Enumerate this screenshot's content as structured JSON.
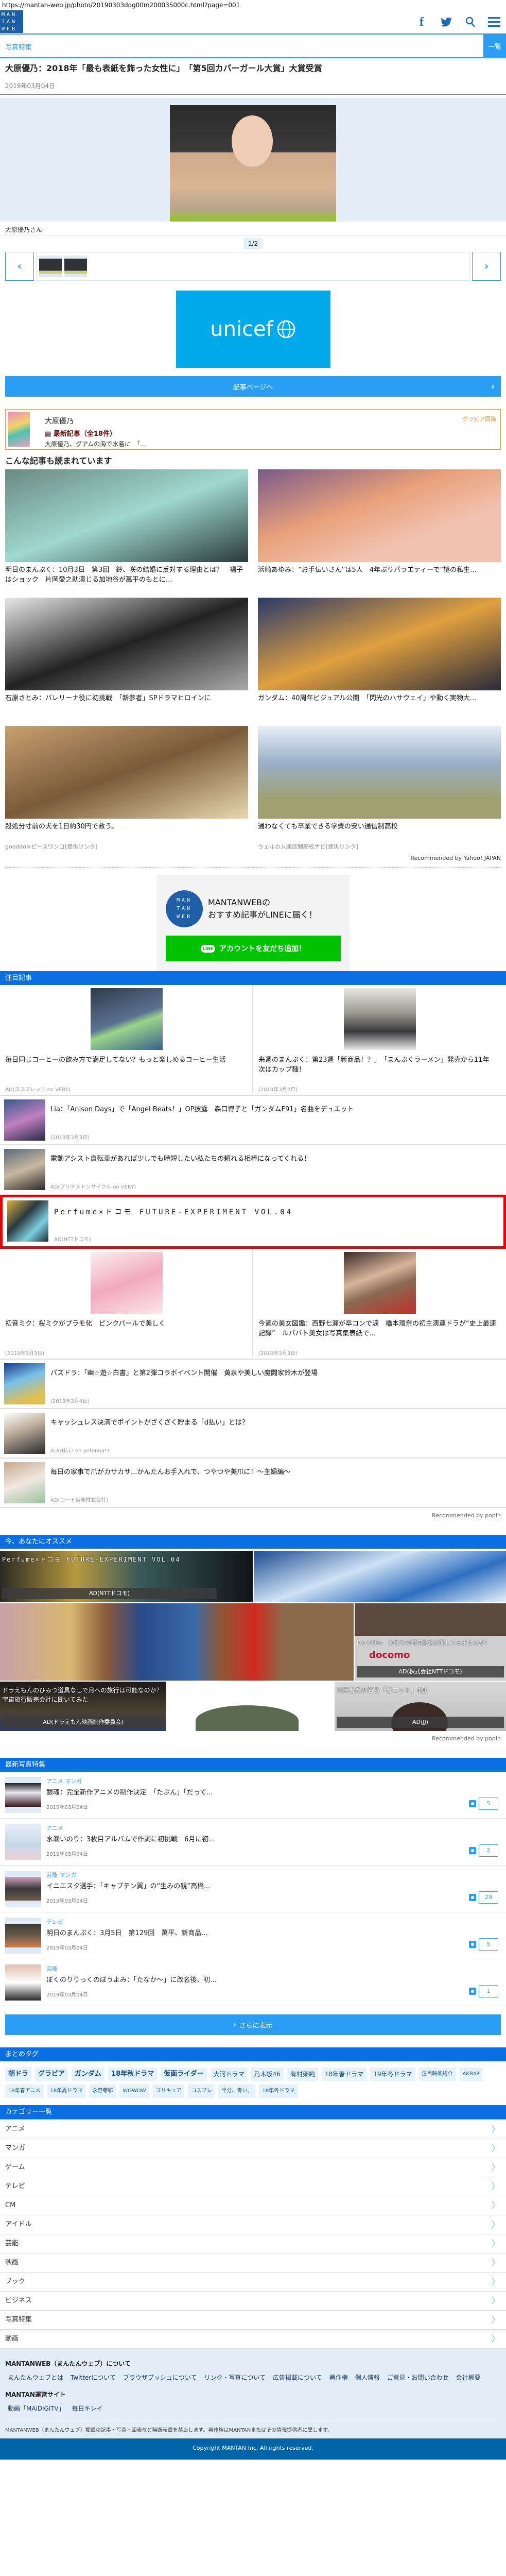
{
  "url": "https://mantan-web.jp/photo/20190303dog00m200035000c.html?page=001",
  "header": {
    "logo": "MAN TAN WEB",
    "icons": [
      "facebook-icon",
      "twitter-icon",
      "search-icon",
      "menu-icon"
    ]
  },
  "subbar": {
    "label": "写真特集",
    "list_button": "一覧"
  },
  "article": {
    "title": "大原優乃：2018年「最も表紙を飾った女性に」　「第5回カバーガール大賞」大賞受賞",
    "date": "2019年03月04日",
    "caption": "大原優乃さん",
    "counter": "1/2",
    "prev": "‹",
    "next": "›"
  },
  "ad": {
    "brand": "unicef"
  },
  "article_button": "記事ページへ",
  "gravure": {
    "name": "大原優乃",
    "latest": "最新記事（全18件）",
    "excerpt": "大原優乃、グアムの海で水着に　「...",
    "label": "グラビア図鑑"
  },
  "read_heading": "こんな記事も読まれています",
  "read_grid": [
    {
      "title": "明日のまんぷく：10月3日　第3回　鈴、咲の結婚に反対する理由とは？　福子はショック　片岡愛之助演じる加地谷が萬平のもとに…",
      "source": ""
    },
    {
      "title": "浜崎あゆみ：“お手伝いさん”は5人　4年ぶりバラエティーで“謎の私生…",
      "source": ""
    },
    {
      "title": "石原さとみ：バレリーナ役に初挑戦　「新参者」SPドラマヒロインに",
      "source": ""
    },
    {
      "title": "ガンダム：40周年ビジュアル公開　「閃光のハサウェイ」や動く実物大…",
      "source": ""
    },
    {
      "title": "殺処分寸前の犬を1日約30円で救う。",
      "source": "gooddo×ピースワンコ[提供リンク]"
    },
    {
      "title": "通わなくても卒業できる学費の安い通信制高校",
      "source": "ウェルカム通信制高校ナビ[提供リンク]"
    }
  ],
  "yahoo_credit": "Recommended by Yahoo! JAPAN",
  "line_promo": {
    "logo": "MAN TAN WEB",
    "line1": "MANTANWEBの",
    "line2": "おすすめ記事がLINEに届く！",
    "button": "アカウントを友だち追加！",
    "button_icon": "LINE"
  },
  "featured": {
    "heading": "注目記事",
    "top": [
      {
        "title": "毎日同じコーヒーの飲み方で満足してない？もっと楽しめるコーヒー生活",
        "source": "AD(ネスプレッソ on VERY)"
      },
      {
        "title": "来週のまんぷく：第23週「新商品！？」　「まんぷくラーメン」発売から11年　次はカップ麺！",
        "source": "(2019年3月2日)"
      }
    ],
    "list1": [
      {
        "title": "Lia：「Anison Days」で「Angel Beats！」OP披露　森口博子と「ガンダムF91」名曲をデュエット",
        "source": "(2019年3月3日)"
      },
      {
        "title": "電動アシスト自転車があれば少しでも時短したい私たちの頼れる相棒になってくれる！",
        "source": "AD(ブリヂストンサイクル on VERY)"
      }
    ],
    "highlight": {
      "title": "Perfume×ドコモ FUTURE-EXPERIMENT VOL.04",
      "source": "AD(NTTドコモ)"
    },
    "mid": [
      {
        "title": "初音ミク：桜ミクがプラモ化　ピンクパールで美しく",
        "source": "(2019年3月3日)"
      },
      {
        "title": "今週の美女図鑑：西野七瀬が卒コンで涙　橋本環奈の初主演連ドラが“史上最速記録”　ルパパト美女は写真集表紙で…",
        "source": "(2019年3月3日)"
      }
    ],
    "list2": [
      {
        "title": "パズドラ：「幽☆遊☆白書」と第2弾コラボイベント開催　黄泉や美しい魔闘家鈴木が登場",
        "source": "(2019年3月4日)"
      },
      {
        "title": "キャッシュレス決済でポイントがざくざく貯まる「d払い」とは？",
        "source": "AD(d払い on antenna*)"
      },
      {
        "title": "毎日の家事で爪がカサカサ...かんたんお手入れで、つやつや美爪に！～主婦編～",
        "source": "AD(ロート製薬株式会社)"
      }
    ],
    "credit": "Recommended by popIn"
  },
  "recommend": {
    "heading": "今、あなたにオススメ",
    "tiles": [
      {
        "title": "Perfume×ドコモ FUTURE-EXPERIMENT VOL.04",
        "source": "AD(NTTドコモ)"
      },
      {
        "title": "",
        "source": ""
      },
      {
        "title": "",
        "source": ""
      },
      {
        "title": "For ONEs　あなたの耳年齢を診断してみませんか？",
        "source": "AD(株式会社NTTドコモ)",
        "brand": "docomo"
      },
      {
        "title": "ドラえもんのひみつ道具なしで月への旅行は可能なのか？宇宙旅行販売会社に聞いてみた",
        "source": "AD(ドラえもん映画制作委員会)"
      },
      {
        "title": "",
        "source": ""
      },
      {
        "title": "川口春奈が着る「春ニット」4選",
        "source": "AD(JJ)"
      }
    ],
    "credit": "Recommended by popIn"
  },
  "latest_photos": {
    "heading": "最新写真特集",
    "items": [
      {
        "category": "アニメ マンガ",
        "title": "銀魂：完全新作アニメの制作決定　「たぶん」「だって...",
        "date": "2019年03月04日",
        "count": "5"
      },
      {
        "category": "アニメ",
        "title": "水瀬いのり：3枚目アルバムで作詞に初挑戦　6月に初...",
        "date": "2019年03月04日",
        "count": "2"
      },
      {
        "category": "芸能 マンガ",
        "title": "イニエスタ選手：「キャプテン翼」の“生みの親”高橋...",
        "date": "2019年03月04日",
        "count": "29"
      },
      {
        "category": "テレビ",
        "title": "明日のまんぷく：3月5日　第129回　萬平、新商品...",
        "date": "2019年03月04日",
        "count": "5"
      },
      {
        "category": "芸能",
        "title": "ぼくのりりっくのぼうよみ：「たなか～」に改名後、初...",
        "date": "2019年03月04日",
        "count": "1"
      }
    ],
    "more_button": "さらに表示"
  },
  "tags": {
    "heading": "まとめタグ",
    "items": [
      "朝ドラ",
      "グラビア",
      "ガンダム",
      "18年秋ドラマ",
      "仮面ライダー",
      "大河ドラマ",
      "乃木坂46",
      "有村架純",
      "18年春ドラマ",
      "19年冬ドラマ",
      "注目映画紹介",
      "AKB48",
      "18年春アニメ",
      "18年夏ドラマ",
      "永野芽郁",
      "WOWOW",
      "プリキュア",
      "コスプレ",
      "半分、青い。",
      "18年冬ドラマ"
    ]
  },
  "categories": {
    "heading": "カテゴリー一覧",
    "items": [
      "アニメ",
      "マンガ",
      "ゲーム",
      "テレビ",
      "CM",
      "アイドル",
      "芸能",
      "映画",
      "ブック",
      "ビジネス",
      "写真特集",
      "動画"
    ]
  },
  "footer": {
    "about_heading": "MANTANWEB（まんたんウェブ）について",
    "about_links": [
      "まんたんウェブとは",
      "Twitterについて",
      "ブラウザプッシュについて",
      "リンク・写真について",
      "広告掲載について",
      "著作権",
      "個人情報",
      "ご意見・お問い合わせ",
      "会社概要"
    ],
    "sites_heading": "MANTAN運営サイト",
    "site_links": [
      "動画「MAiDiGiTV」",
      "毎日キレイ"
    ],
    "note": "MANTANWEB（まんたんウェブ）掲載の記事・写真・図表など無断転載を禁止します。著作権はMANTANまたはその情報提供者に属します。",
    "copyright": "Copyright MANTAN Inc. All rights reserved."
  },
  "colors": {
    "accent": "#2a9df4",
    "section": "#0b6fe3",
    "footer": "#0064a8",
    "highlight_border": "#ee0000",
    "line_green": "#00c300"
  }
}
